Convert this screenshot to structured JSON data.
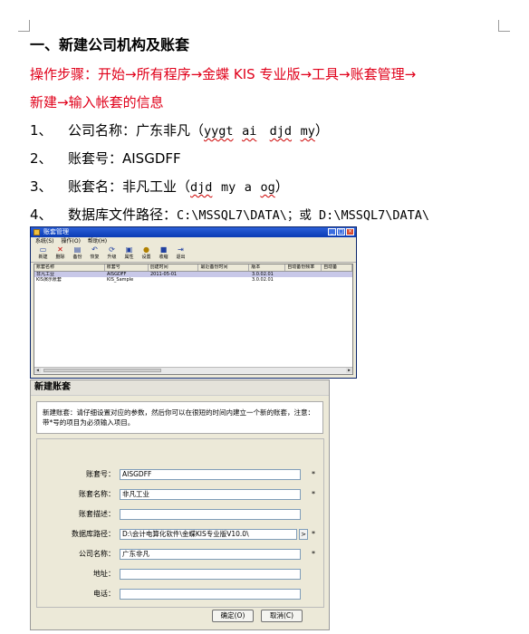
{
  "heading": "一、新建公司机构及账套",
  "steps": {
    "line1": "操作步骤：开始→所有程序→金蝶 KIS 专业版→工具→账套管理→",
    "line2": "新建→输入帐套的信息"
  },
  "items": [
    {
      "num": "1、",
      "label": "公司名称：广东非凡（",
      "p1": "yygt",
      "p2": "ai",
      "p3": "djd",
      "p4": "my",
      "end": "）"
    },
    {
      "num": "2、",
      "label": "账套号：AISGDFF"
    },
    {
      "num": "3、",
      "label": "账套名：非凡工业（",
      "p1": "djd",
      "p2": "my",
      "p3": "a",
      "p4": "og",
      "end": "）"
    },
    {
      "num": "4、",
      "label": "数据库文件路径：",
      "path": "C:\\MSSQL7\\DATA\\；或 D:\\MSSQL7\\DATA\\"
    }
  ],
  "window1": {
    "title": "账套管理",
    "menu": [
      "系统(S)",
      "操作(O)",
      "帮助(H)"
    ],
    "toolbar": [
      {
        "icon": "new-icon",
        "label": "新建"
      },
      {
        "icon": "delete-icon",
        "label": "删除"
      },
      {
        "icon": "backup-icon",
        "label": "备份"
      },
      {
        "icon": "restore-icon",
        "label": "恢复"
      },
      {
        "icon": "refresh-icon",
        "label": "升级"
      },
      {
        "icon": "property-icon",
        "label": "属性"
      },
      {
        "icon": "settings-icon",
        "label": "设置"
      },
      {
        "icon": "collect-icon",
        "label": "收缩"
      },
      {
        "icon": "exit-icon",
        "label": "退出"
      }
    ],
    "columns": [
      "账套名称",
      "账套号",
      "创建时间",
      "最近备份时间",
      "版本",
      "自动备份频率",
      "自动备"
    ],
    "rows": [
      [
        "非凡工业",
        "AISGDFF",
        "2011-05-01",
        "",
        "3.0.02.01",
        "",
        ""
      ],
      [
        "KIS演示账套",
        "KIS_Sample",
        "",
        "",
        "3.0.02.01",
        "",
        ""
      ]
    ]
  },
  "window2": {
    "title": "新建账套",
    "description": "新建账套：请仔细设置对应的参数，然后你可以在很短的时间内建立一个新的账套，注意：带*号的项目为必须输入项目。",
    "fields": [
      {
        "label": "账套号：",
        "value": "AISGDFF",
        "required": "*"
      },
      {
        "label": "账套名称：",
        "value": "非凡工业",
        "required": "*"
      },
      {
        "label": "账套描述：",
        "value": "",
        "required": ""
      },
      {
        "label": "数据库路径：",
        "value": "D:\\会计电算化软件\\金蝶KIS专业版V10.0\\",
        "required": "*"
      },
      {
        "label": "公司名称：",
        "value": "广东非凡",
        "required": "*"
      },
      {
        "label": "地址：",
        "value": "",
        "required": ""
      },
      {
        "label": "电话：",
        "value": "",
        "required": ""
      }
    ],
    "browse": ">",
    "ok": "确定(O)",
    "cancel": "取消(C)"
  }
}
